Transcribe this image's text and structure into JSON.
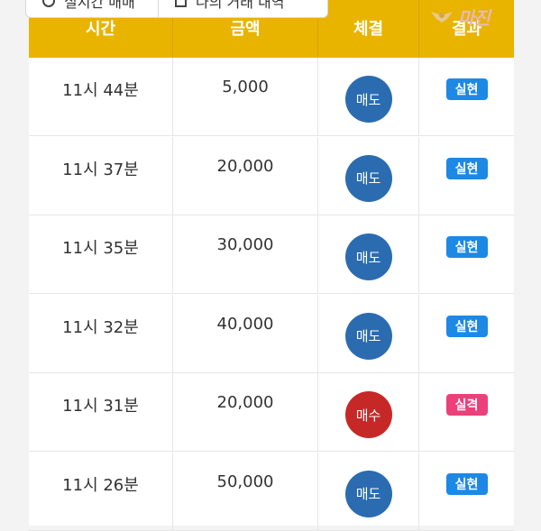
{
  "tabs": [
    {
      "label": "실시간 매매"
    },
    {
      "label": "나의 거래 내역"
    }
  ],
  "logo": {
    "text": "마진"
  },
  "table": {
    "headers": [
      "시간",
      "금액",
      "체결",
      "결과"
    ],
    "rows": [
      {
        "time": "11시 44분",
        "amount": "5,000",
        "trade": "매도",
        "result": "실현"
      },
      {
        "time": "11시 37분",
        "amount": "20,000",
        "trade": "매도",
        "result": "실현"
      },
      {
        "time": "11시 35분",
        "amount": "30,000",
        "trade": "매도",
        "result": "실현"
      },
      {
        "time": "11시 32분",
        "amount": "40,000",
        "trade": "매도",
        "result": "실현"
      },
      {
        "time": "11시 31분",
        "amount": "20,000",
        "trade": "매수",
        "result": "실격"
      },
      {
        "time": "11시 26분",
        "amount": "50,000",
        "trade": "매도",
        "result": "실현"
      }
    ]
  },
  "colors": {
    "header_bg": "#e8b400",
    "sell": "#2b6cb0",
    "buy": "#c62828",
    "realized": "#1e88e5",
    "failed": "#ec407a"
  }
}
